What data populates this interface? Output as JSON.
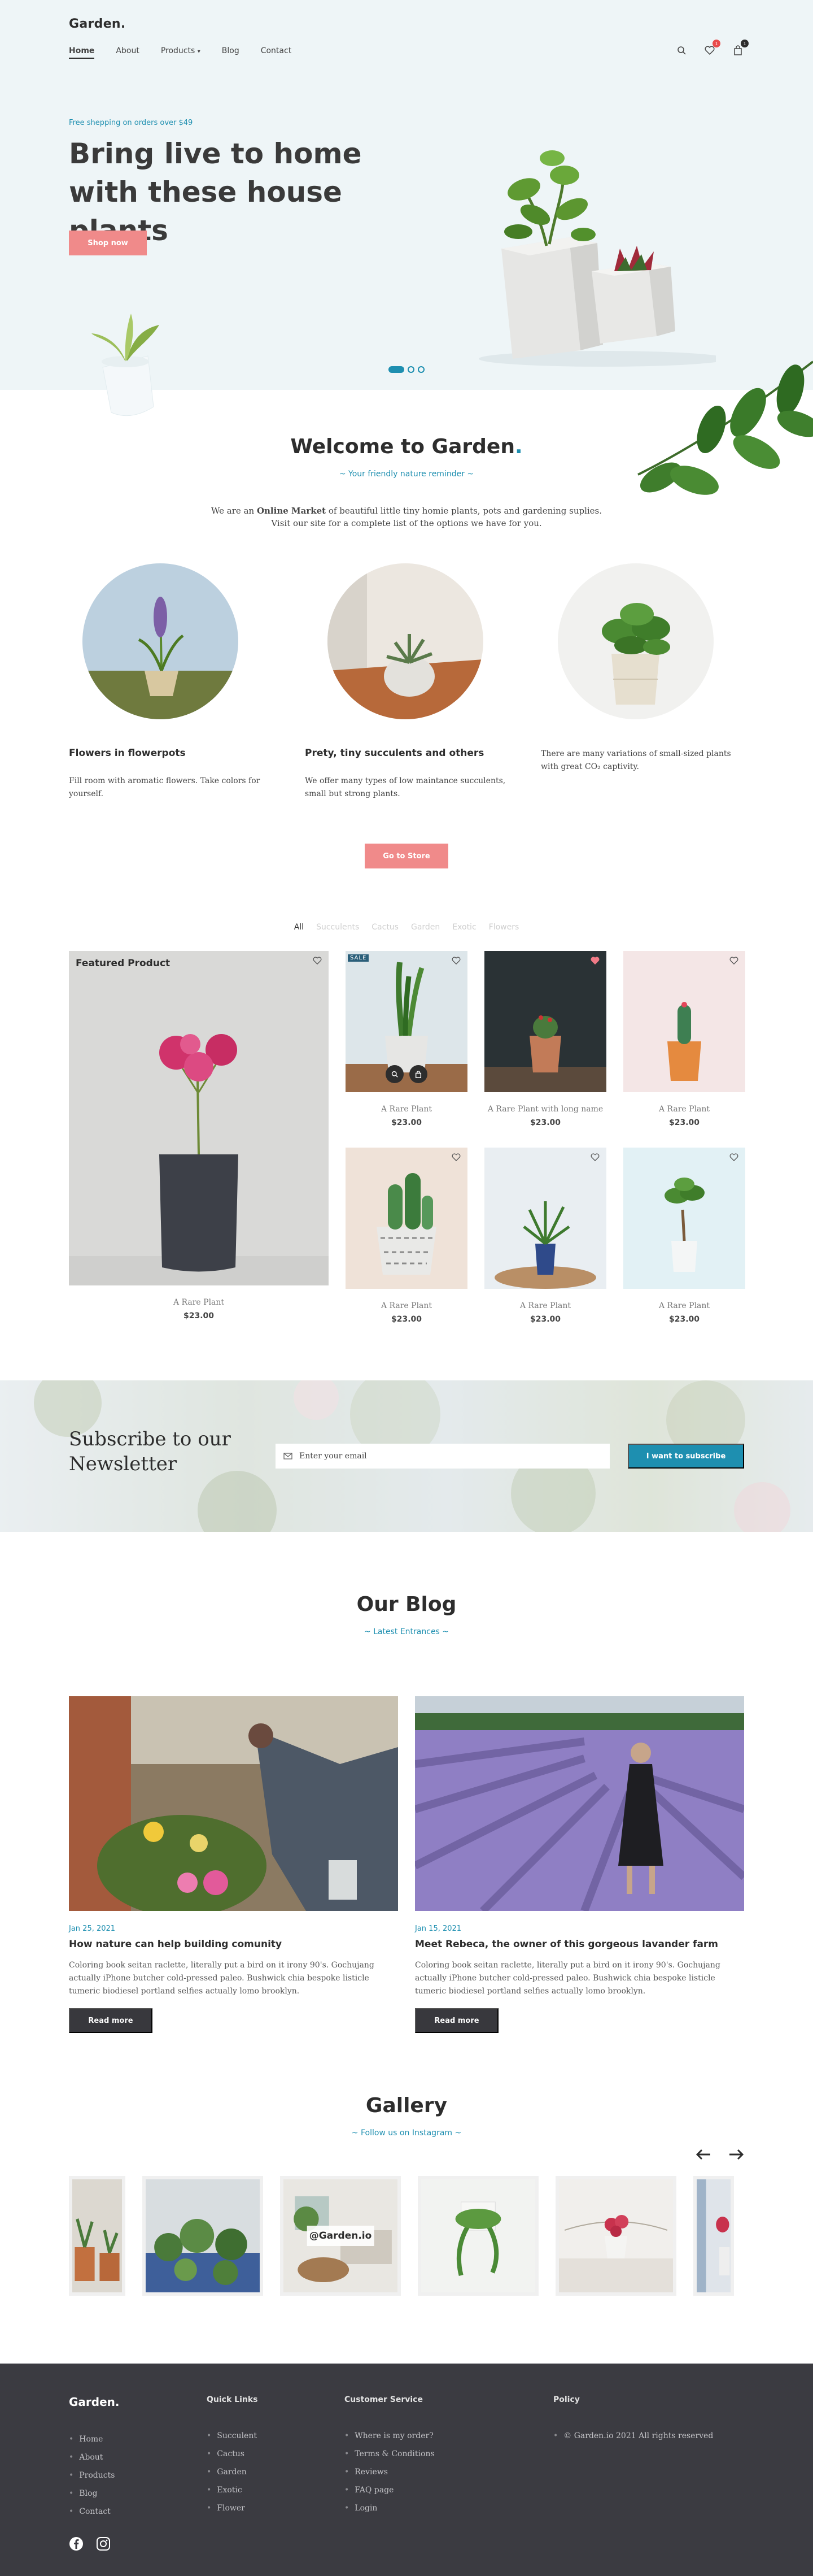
{
  "brand": {
    "logo": "Garden.",
    "accent": "#1e8fb0",
    "pink": "#f08a8a",
    "dark": "#3b3b41"
  },
  "nav": {
    "items": [
      "Home",
      "About",
      "Products",
      "Blog",
      "Contact"
    ],
    "active": "Home",
    "wishlist_count": "1",
    "cart_count": "1"
  },
  "hero": {
    "promo": "Free shepping on orders over $49",
    "title": "Bring live to home with these house plants",
    "cta": "Shop now"
  },
  "welcome": {
    "title": "Welcome to Garden",
    "title_dot": ".",
    "subtitle": "~ Your friendly nature reminder ~",
    "text_pre": "We are an ",
    "text_bold": "Online Market",
    "text_post": " of beautiful little tiny homie plants, pots and gardening suplies.",
    "text_line2": "Visit our site for a complete list of the options we have for you.",
    "features": [
      {
        "title": "Flowers in flowerpots",
        "text": "Fill room with aromatic flowers. Take colors for yourself."
      },
      {
        "title": "Prety, tiny succulents  and others",
        "text": "We offer many types of low maintance succulents, small but strong plants."
      },
      {
        "title": "",
        "text": "There are many variations of small-sized plants with great CO₂ captivity."
      }
    ],
    "cta": "Go to Store"
  },
  "products": {
    "filters": [
      "All",
      "Succulents",
      "Cactus",
      "Garden",
      "Exotic",
      "Flowers"
    ],
    "active_filter": "All",
    "featured": {
      "label": "Featured Product",
      "name": "A Rare Plant",
      "price": "$23.00"
    },
    "items": [
      {
        "name": "A Rare Plant",
        "price": "$23.00",
        "sale": "SALE",
        "liked": false
      },
      {
        "name": "A Rare Plant with long name",
        "price": "$23.00",
        "liked": true
      },
      {
        "name": "A Rare Plant",
        "price": "$23.00",
        "liked": false
      },
      {
        "name": "A Rare Plant",
        "price": "$23.00",
        "liked": false
      },
      {
        "name": "A Rare Plant",
        "price": "$23.00",
        "liked": false
      },
      {
        "name": "A Rare Plant",
        "price": "$23.00",
        "liked": false
      }
    ]
  },
  "newsletter": {
    "title": "Subscribe to our Newsletter",
    "placeholder": "Enter your email",
    "button": "I want to subscribe"
  },
  "blog": {
    "title": "Our Blog",
    "subtitle": "~ Latest Entrances ~",
    "posts": [
      {
        "date": "Jan 25, 2021",
        "title": "How nature can help building comunity",
        "text": "Coloring book seitan raclette, literally put a bird on it irony 90's. Gochujang actually iPhone butcher cold-pressed paleo. Bushwick chia bespoke listicle tumeric biodiesel portland selfies actually lomo brooklyn.",
        "cta": "Read more"
      },
      {
        "date": "Jan 15, 2021",
        "title": "Meet Rebeca, the owner of this gorgeous lavander farm",
        "text": "Coloring book seitan raclette, literally put a bird on it irony 90's. Gochujang actually iPhone butcher cold-pressed paleo. Bushwick chia bespoke listicle tumeric biodiesel portland selfies actually lomo brooklyn.",
        "cta": "Read more"
      }
    ]
  },
  "gallery": {
    "title": "Gallery",
    "subtitle": "~ Follow us on Instagram ~",
    "handle": "@Garden.io"
  },
  "footer": {
    "logo": "Garden.",
    "main_links": [
      "Home",
      "About",
      "Products",
      "Blog",
      "Contact"
    ],
    "quick_links_title": "Quick Links",
    "quick_links": [
      "Succulent",
      "Cactus",
      "Garden",
      "Exotic",
      "Flower"
    ],
    "service_title": "Customer Service",
    "service_links": [
      "Where is my order?",
      "Terms & Conditions",
      "Reviews",
      "FAQ page",
      "Login"
    ],
    "policy_title": "Policy",
    "copyright": "© Garden.io 2021 All rights reserved"
  }
}
